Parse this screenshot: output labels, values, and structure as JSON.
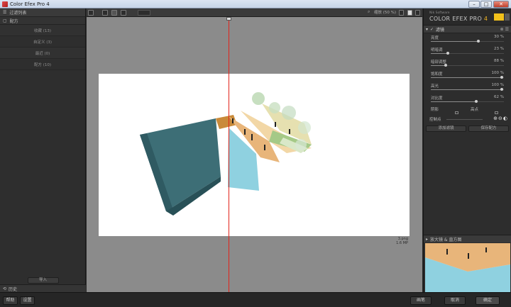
{
  "window": {
    "title": "Color Efex Pro 4",
    "minimize": "–",
    "maximize": "□",
    "close": "✕"
  },
  "left_panel": {
    "header": "过滤列表",
    "subheader": "配方",
    "categories": [
      "收藏 (13)",
      "自定义 (3)",
      "最近 (0)",
      "配方 (10)"
    ],
    "import_label": "导入",
    "history_label": "历史"
  },
  "toolbar": {
    "zoom_label": "缩放 (50 %)"
  },
  "canvas": {
    "file_name": "3.png",
    "file_size": "1.6 MP"
  },
  "right_panel": {
    "brand_sub": "Nik Software",
    "brand_main": "COLOR EFEX PRO",
    "brand_ver": "4",
    "filter_name": "滤镜",
    "sliders": [
      {
        "label": "亮度",
        "value": "30 %",
        "fraction": 0.65
      },
      {
        "label": "明暗调",
        "value": "23 %",
        "fraction": 0.23
      },
      {
        "label": "暗部调整",
        "value": "88 %",
        "fraction": 0.2
      },
      {
        "label": "饱和度",
        "value": "100 %",
        "fraction": 0.97
      },
      {
        "label": "高光",
        "value": "100 %",
        "fraction": 0.97
      },
      {
        "label": "对比度",
        "value": "62 %",
        "fraction": 0.62
      }
    ],
    "tone_left": "阴影",
    "tone_right": "高点",
    "control_point_label": "控制点",
    "add_filter": "添加滤镜",
    "save_recipe": "保存配方",
    "loupe_label": "放大镜 & 直方图"
  },
  "bottom_bar": {
    "help": "帮助",
    "settings": "设置",
    "brush": "画笔",
    "cancel": "取消",
    "ok": "确定"
  },
  "colors": {
    "accent": "#e2231a",
    "brand": "#f2c11b",
    "water": "#4f8a94"
  }
}
